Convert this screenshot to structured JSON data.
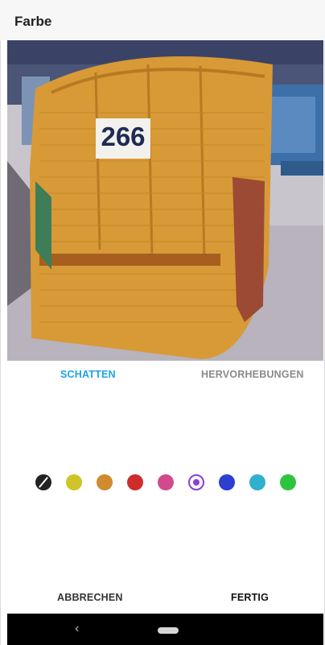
{
  "header": {
    "title": "Farbe"
  },
  "photo": {
    "number_sign": "266"
  },
  "tabs": [
    {
      "label": "SCHATTEN",
      "active": true,
      "color": "#1aa3e8"
    },
    {
      "label": "HERVORHEBUNGEN",
      "active": false,
      "color": "#8a8a8a"
    }
  ],
  "swatches": [
    {
      "name": "none",
      "color": "#222222",
      "selected": false
    },
    {
      "name": "yellow",
      "color": "#cfc42a",
      "selected": false
    },
    {
      "name": "orange",
      "color": "#d18a2e",
      "selected": false
    },
    {
      "name": "red",
      "color": "#cf2c2c",
      "selected": false
    },
    {
      "name": "pink",
      "color": "#d14b8c",
      "selected": false
    },
    {
      "name": "purple",
      "color": "#8a3fd6",
      "selected": true
    },
    {
      "name": "blue",
      "color": "#2c3fd1",
      "selected": false
    },
    {
      "name": "cyan",
      "color": "#2fb0cf",
      "selected": false
    },
    {
      "name": "green",
      "color": "#2fc43f",
      "selected": false
    }
  ],
  "actions": {
    "cancel_label": "ABBRECHEN",
    "done_label": "FERTIG"
  },
  "nav": {
    "back_icon": "‹",
    "home_icon": "home-pill"
  }
}
